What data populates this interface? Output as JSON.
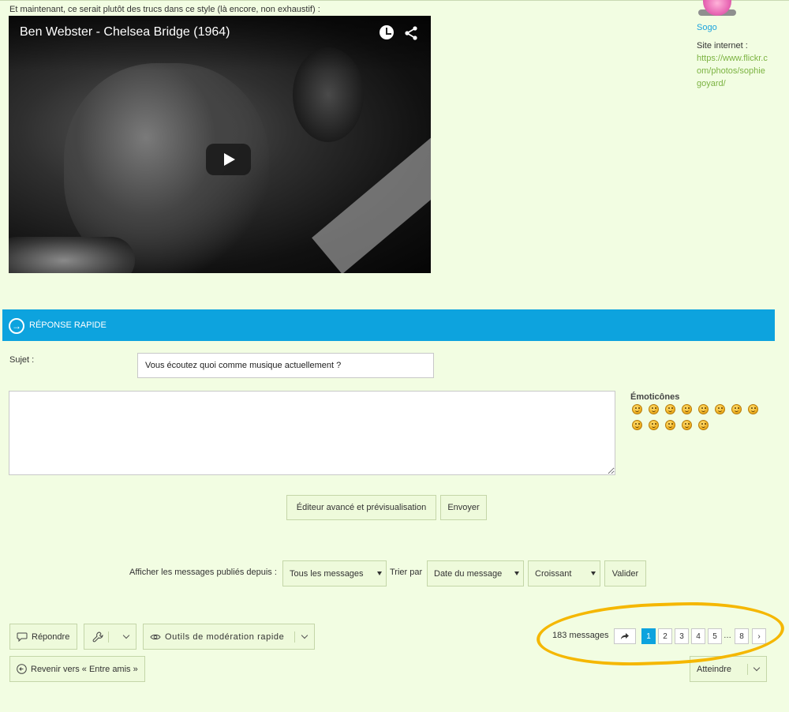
{
  "post": {
    "intro_text": "Et maintenant, ce serait plutôt des trucs dans ce style (là encore, non exhaustif) :",
    "video": {
      "title": "Ben Webster - Chelsea Bridge (1964)"
    }
  },
  "profile": {
    "username": "Sogo",
    "site_label": "Site internet :",
    "site_url": "https://www.flickr.com/photos/sophiegoyard/"
  },
  "quick_reply": {
    "header": "RÉPONSE RAPIDE",
    "subject_label": "Sujet :",
    "subject_value": "Vous écoutez quoi comme musique actuellement ?",
    "message_value": "",
    "emoticons_title": "Émoticônes",
    "emoticons": [
      "smile",
      "happy",
      "laugh",
      "grin",
      "question",
      "cool",
      "lol",
      "sad",
      "wink",
      "confused",
      "arrow",
      "surprised",
      "angry"
    ],
    "editor_button": "Éditeur avancé et prévisualisation",
    "send_button": "Envoyer"
  },
  "filters": {
    "show_label": "Afficher les messages publiés depuis :",
    "show_value": "Tous les messages",
    "sort_label": "Trier par",
    "sort_value": "Date du message",
    "order_value": "Croissant",
    "validate_button": "Valider"
  },
  "actions": {
    "reply_button": "Répondre",
    "mod_tools_button": "Outils de modération rapide",
    "back_button": "Revenir vers « Entre amis »",
    "goto_button": "Atteindre"
  },
  "pagination": {
    "count_text": "183 messages",
    "pages": [
      "1",
      "2",
      "3",
      "4",
      "5"
    ],
    "dots": "…",
    "last_page": "8",
    "next": "›",
    "current_page": "1"
  },
  "colors": {
    "background": "#f2fde2",
    "header_blue": "#0da3de",
    "link_green": "#7cb342",
    "username_blue": "#1aa3dd",
    "highlight": "#f5b700"
  }
}
